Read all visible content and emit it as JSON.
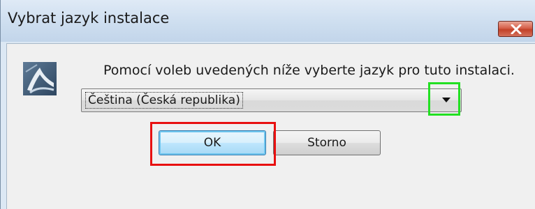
{
  "dialog": {
    "title": "Vybrat jazyk instalace",
    "message": "Pomocí voleb uvedených níže vyberte jazyk pro tuto instalaci.",
    "language_select": {
      "selected": "Čeština (Česká republika)"
    },
    "ok_label": "OK",
    "cancel_label": "Storno"
  },
  "icons": {
    "close": "close-icon",
    "logo": "installer-logo-icon",
    "dropdown": "chevron-down-icon"
  },
  "colors": {
    "highlight_green": "#22e022",
    "highlight_red": "#e81010",
    "close_button": "#c24128",
    "ok_button_border": "#3c7fb1"
  }
}
